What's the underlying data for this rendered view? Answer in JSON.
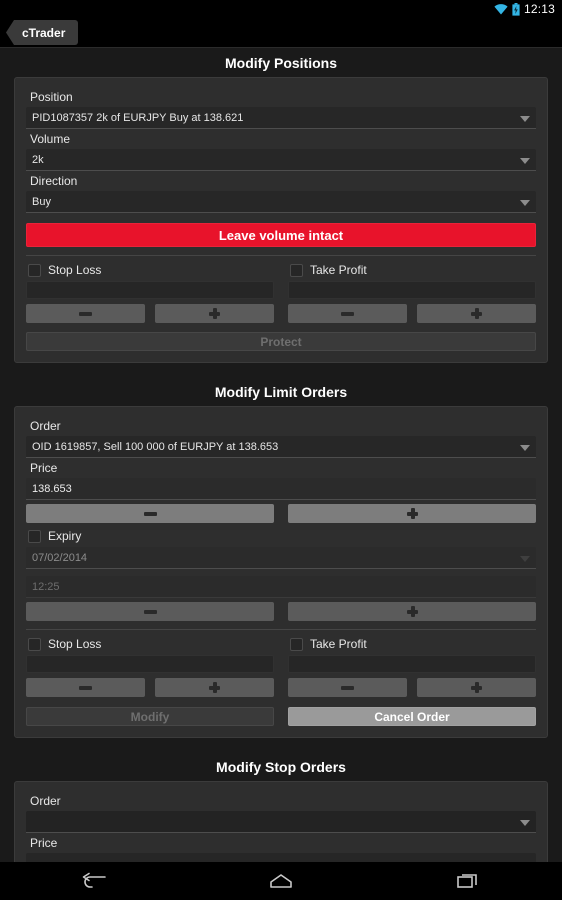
{
  "status_bar": {
    "time": "12:13",
    "wifi_icon": "wifi-icon",
    "battery_icon": "battery-icon",
    "accent_color": "#33b5e5"
  },
  "action_bar": {
    "app_tab_label": "cTrader"
  },
  "sections": {
    "positions": {
      "title": "Modify Positions",
      "position_label": "Position",
      "position_value": "PID1087357 2k of EURJPY Buy at 138.621",
      "volume_label": "Volume",
      "volume_value": "2k",
      "direction_label": "Direction",
      "direction_value": "Buy",
      "leave_volume_label": "Leave volume intact",
      "leave_volume_color": "#e8132b",
      "stop_loss_label": "Stop Loss",
      "stop_loss_value": "",
      "take_profit_label": "Take Profit",
      "take_profit_value": "",
      "minus_label": "−",
      "plus_label": "+",
      "protect_label": "Protect"
    },
    "limit_orders": {
      "title": "Modify Limit Orders",
      "order_label": "Order",
      "order_value": "OID 1619857, Sell 100 000 of EURJPY at 138.653",
      "price_label": "Price",
      "price_value": "138.653",
      "expiry_label": "Expiry",
      "expiry_date": "07/02/2014",
      "expiry_time": "12:25",
      "stop_loss_label": "Stop Loss",
      "stop_loss_value": "",
      "take_profit_label": "Take Profit",
      "take_profit_value": "",
      "modify_label": "Modify",
      "cancel_order_label": "Cancel Order"
    },
    "stop_orders": {
      "title": "Modify Stop Orders",
      "order_label": "Order",
      "order_value": "",
      "price_label": "Price",
      "price_value": ""
    }
  },
  "nav_bar": {
    "back_icon": "back-icon",
    "home_icon": "home-icon",
    "recents_icon": "recents-icon"
  }
}
